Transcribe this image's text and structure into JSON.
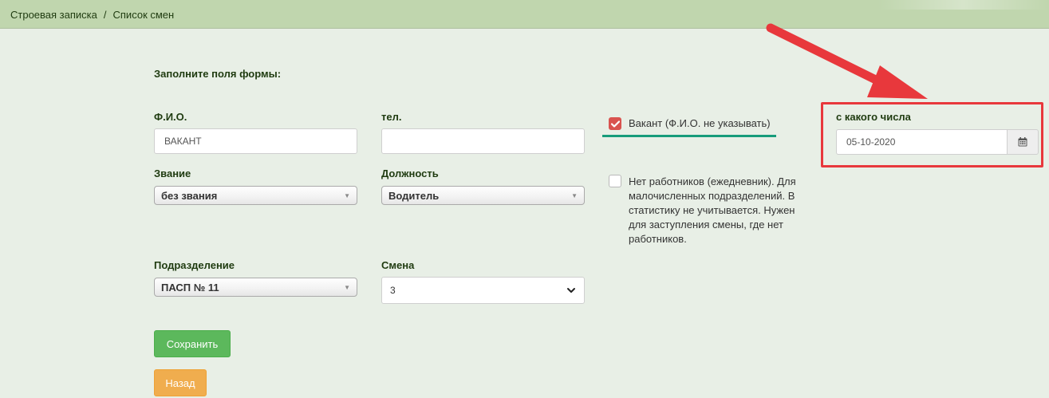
{
  "breadcrumb": {
    "root": "Строевая записка",
    "separator": "/",
    "current": "Список смен"
  },
  "form": {
    "title": "Заполните поля формы:",
    "fio": {
      "label": "Ф.И.О.",
      "value": "ВАКАНТ"
    },
    "phone": {
      "label": "тел.",
      "value": ""
    },
    "rank": {
      "label": "Звание",
      "value": "без звания"
    },
    "position": {
      "label": "Должность",
      "value": "Водитель"
    },
    "division": {
      "label": "Подразделение",
      "value": "ПАСП № 11"
    },
    "shift": {
      "label": "Смена",
      "value": "3"
    },
    "vacant_checkbox": {
      "label": "Вакант (Ф.И.О. не указывать)",
      "checked": true
    },
    "no_workers_checkbox": {
      "label_lines": [
        "Нет работников (ежедневник). Для",
        "малочисленных подразделений. В",
        "статистику не учитывается. Нужен",
        "для заступления смены, где нет",
        "работников."
      ],
      "checked": false
    },
    "from_date": {
      "label": "с какого числа",
      "value": "05-10-2020",
      "icon": "calendar-icon"
    },
    "save_label": "Сохранить",
    "back_label": "Назад"
  },
  "colors": {
    "topbar": "#c0d6ae",
    "background": "#e8efe6",
    "save_button": "#5cb85c",
    "back_button": "#f0ad4e",
    "checkbox_checked": "#d9534f",
    "annotation_red": "#e8383c",
    "annotation_teal": "#179c7b"
  }
}
